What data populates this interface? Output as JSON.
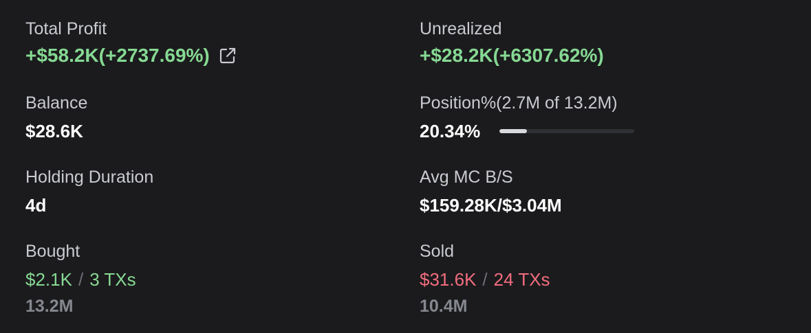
{
  "total_profit": {
    "label": "Total Profit",
    "value": "+$58.2K(+2737.69%)",
    "icon": "external-link-icon"
  },
  "unrealized": {
    "label": "Unrealized",
    "value": "+$28.2K(+6307.62%)"
  },
  "balance": {
    "label": "Balance",
    "value": "$28.6K"
  },
  "position": {
    "label": "Position%(2.7M of 13.2M)",
    "value": "20.34%",
    "fill_percent": 20.34
  },
  "holding_duration": {
    "label": "Holding Duration",
    "value": "4d"
  },
  "avg_mc": {
    "label": "Avg MC B/S",
    "value": "$159.28K/$3.04M"
  },
  "bought": {
    "label": "Bought",
    "amount": "$2.1K",
    "separator": "/",
    "txs": "3 TXs",
    "tokens": "13.2M"
  },
  "sold": {
    "label": "Sold",
    "amount": "$31.6K",
    "separator": "/",
    "txs": "24 TXs",
    "tokens": "10.4M"
  },
  "colors": {
    "background": "#1b1b1d",
    "positive": "#86d993",
    "negative": "#f26d7e",
    "muted": "#85888f"
  }
}
